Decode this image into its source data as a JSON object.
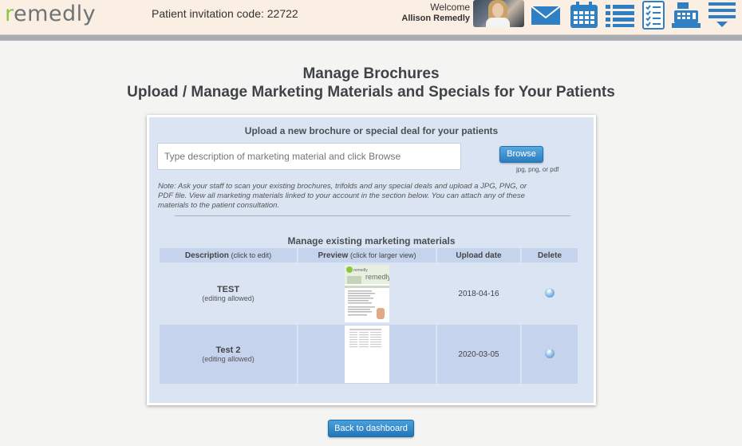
{
  "header": {
    "logo_text": "remedly",
    "invitation_label": "Patient invitation code: 22722",
    "welcome_label": "Welcome",
    "user_name": "Allison Remedly",
    "nav_icons": [
      "mail-icon",
      "calendar-icon",
      "list-icon",
      "checklist-icon",
      "cash-register-icon",
      "menu-icon"
    ]
  },
  "page": {
    "title_line1": "Manage Brochures",
    "title_line2": "Upload / Manage Marketing Materials and Specials for Your Patients"
  },
  "upload": {
    "heading": "Upload a new brochure or special deal for your patients",
    "input_placeholder": "Type description of marketing material and click Browse",
    "browse_label": "Browse",
    "file_types": "jpg, png, or pdf",
    "note": "Note: Ask your staff to scan your existing brochures, trifolds and any special deals and upload a JPG, PNG, or PDF file. View all marketing materials linked to your account in the section below. You can attach any of these materials to the patient consultation."
  },
  "manage": {
    "heading": "Manage existing marketing materials",
    "columns": {
      "description": "Description",
      "description_sub": "(click to edit)",
      "preview": "Preview",
      "preview_sub": "(click for larger view)",
      "upload_date": "Upload date",
      "delete": "Delete"
    },
    "rows": [
      {
        "name": "TEST",
        "edit_note": "(editing allowed)",
        "date": "2018-04-16",
        "thumb_brand": "remedly"
      },
      {
        "name": "Test 2",
        "edit_note": "(editing allowed)",
        "date": "2020-03-05"
      }
    ]
  },
  "footer": {
    "back_label": "Back to dashboard"
  },
  "colors": {
    "accent": "#2a7fc0",
    "header_bg": "#fbeee2",
    "panel_bg": "#dae4f3",
    "logo_green": "#8cc63f"
  }
}
